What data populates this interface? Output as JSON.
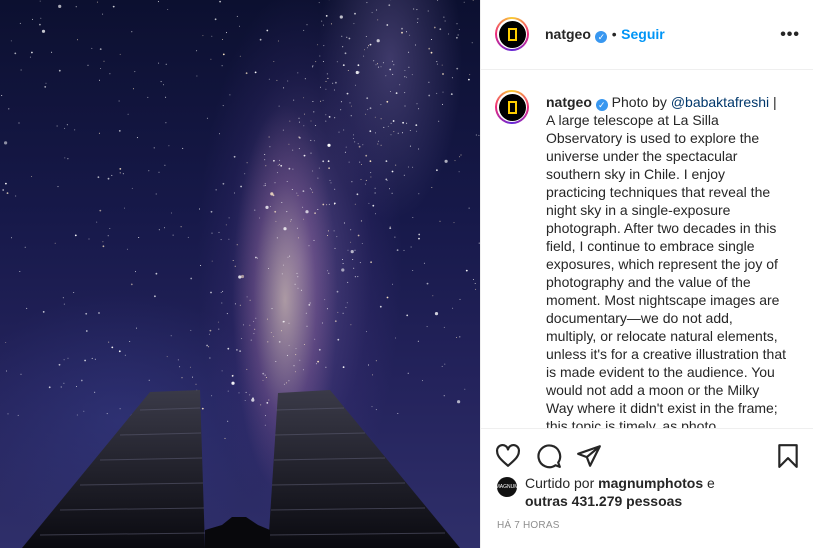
{
  "post": {
    "username": "natgeo",
    "follow_label": "Seguir",
    "separator": "•",
    "more_label": "•••",
    "caption_prefix": "Photo by ",
    "caption_mention": "@babaktafreshi",
    "caption_body": " | A large telescope at La Silla Observatory is used to explore the universe under the spectacular southern sky in Chile. I enjoy practicing techniques that reveal the night sky in a single-exposure photograph. After two decades in this field, I continue to embrace single exposures, which represent the joy of photography and the value of the moment. Most nightscape images are documentary—we do not add, multiply, or relocate natural elements, unless it's for a creative illustration that is made evident to the audience. You would not add a moon or the Milky Way where it didn't exist in the frame; this topic is timely, as photo",
    "liked_prefix": "Curtido por ",
    "liked_user": "magnumphotos",
    "liked_middle": " e ",
    "liked_others": "outras 431.279 pessoas",
    "mini_avatar_text": "MAGNUM",
    "timestamp": "HÁ 7 HORAS"
  },
  "icons": {
    "like": "heart-icon",
    "comment": "comment-icon",
    "share": "share-icon",
    "save": "bookmark-icon",
    "verified": "verified-badge-icon",
    "more": "more-options-icon"
  },
  "colors": {
    "accent": "#0095f6",
    "verified": "#3897f0",
    "logo_yellow": "#ffce00"
  }
}
